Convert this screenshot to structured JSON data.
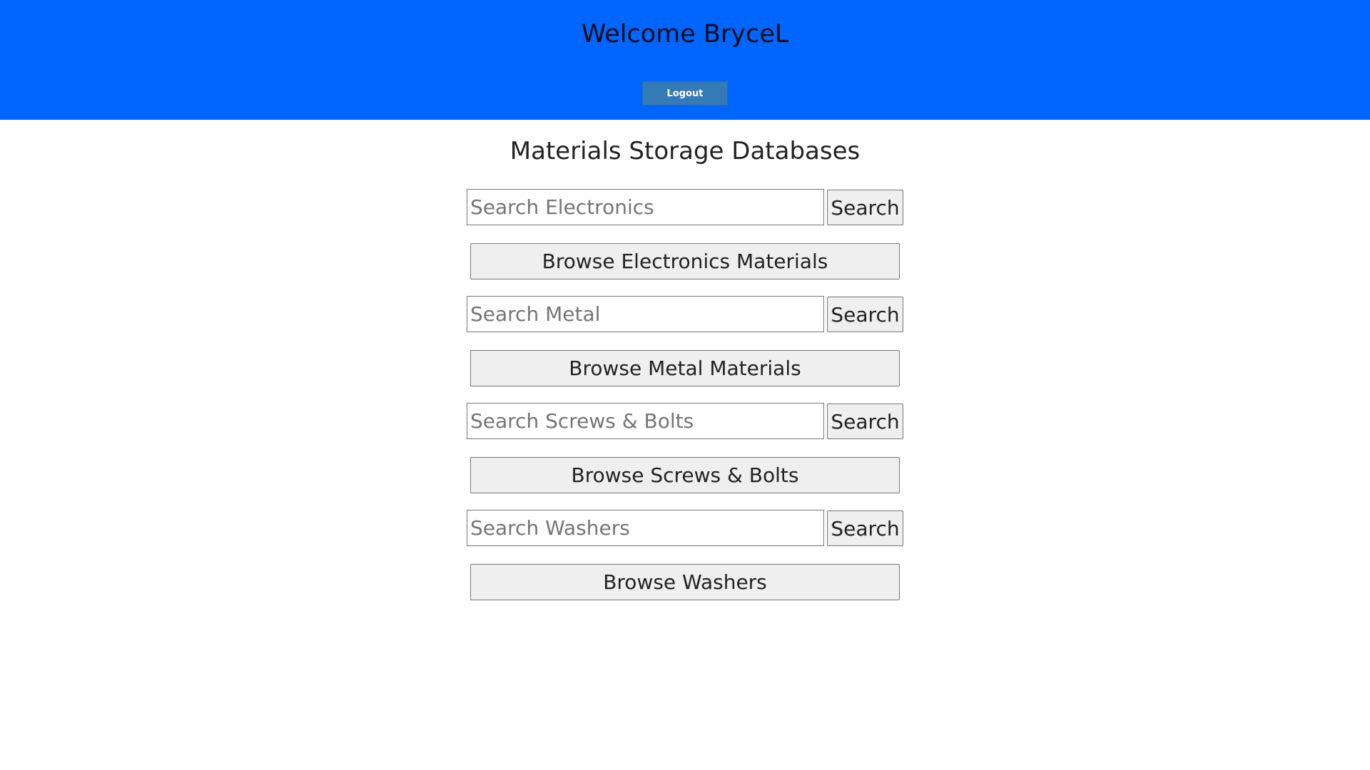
{
  "header": {
    "welcome_text": "Welcome BryceL",
    "logout_label": "Logout"
  },
  "main": {
    "title": "Materials Storage Databases",
    "sections": [
      {
        "search_placeholder": "Search Electronics",
        "search_label": "Search",
        "browse_label": "Browse Electronics Materials"
      },
      {
        "search_placeholder": "Search Metal",
        "search_label": "Search",
        "browse_label": "Browse Metal Materials"
      },
      {
        "search_placeholder": "Search Screws & Bolts",
        "search_label": "Search",
        "browse_label": "Browse Screws & Bolts"
      },
      {
        "search_placeholder": "Search Washers",
        "search_label": "Search",
        "browse_label": "Browse Washers"
      }
    ]
  },
  "colors": {
    "header_background": "#0066ff",
    "logout_button": "#337ab7",
    "button_background": "#efefef"
  }
}
